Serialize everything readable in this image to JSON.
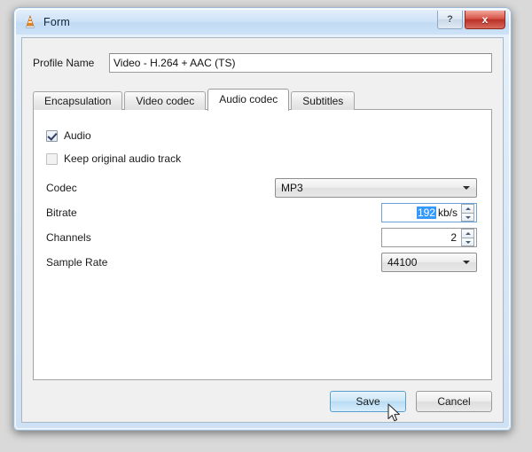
{
  "window": {
    "title": "Form",
    "icon": "vlc-cone-icon",
    "controls": [
      {
        "name": "help-button",
        "label": "?"
      },
      {
        "name": "close-button",
        "label": "x"
      }
    ]
  },
  "profile": {
    "label": "Profile Name",
    "value": "Video - H.264 + AAC (TS)"
  },
  "tabs": [
    {
      "label": "Encapsulation",
      "active": false
    },
    {
      "label": "Video codec",
      "active": false
    },
    {
      "label": "Audio codec",
      "active": true
    },
    {
      "label": "Subtitles",
      "active": false
    }
  ],
  "audio_panel": {
    "audio_checkbox": {
      "label": "Audio",
      "checked": true
    },
    "keep_original_checkbox": {
      "label": "Keep original audio track",
      "checked": false
    },
    "codec": {
      "label": "Codec",
      "value": "MP3"
    },
    "bitrate": {
      "label": "Bitrate",
      "value": "192",
      "unit": "kb/s",
      "selected": true
    },
    "channels": {
      "label": "Channels",
      "value": "2"
    },
    "sample_rate": {
      "label": "Sample Rate",
      "value": "44100"
    }
  },
  "buttons": {
    "save": "Save",
    "cancel": "Cancel"
  },
  "colors": {
    "selection_blue": "#3399ff",
    "titlebar_blue": "#c9e0f5",
    "close_red": "#bb3226",
    "accent_button": "#b9dcf4"
  }
}
